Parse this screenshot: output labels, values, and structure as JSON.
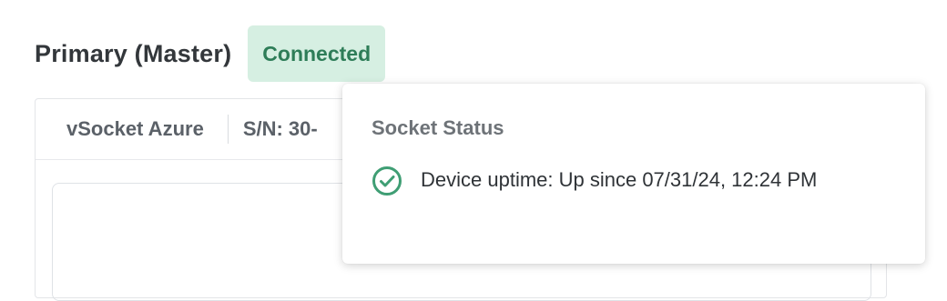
{
  "site": {
    "title": "Primary (Master)",
    "status": "Connected"
  },
  "device": {
    "name": "vSocket Azure",
    "serial_label": "S/N: 30-"
  },
  "popover": {
    "title": "Socket Status",
    "uptime_text": "Device uptime: Up since 07/31/24, 12:24 PM",
    "status_icon": "check-circle-icon"
  },
  "colors": {
    "connected_bg": "#d6efe2",
    "connected_text": "#2e7d58",
    "success_icon": "#3f9e74"
  }
}
